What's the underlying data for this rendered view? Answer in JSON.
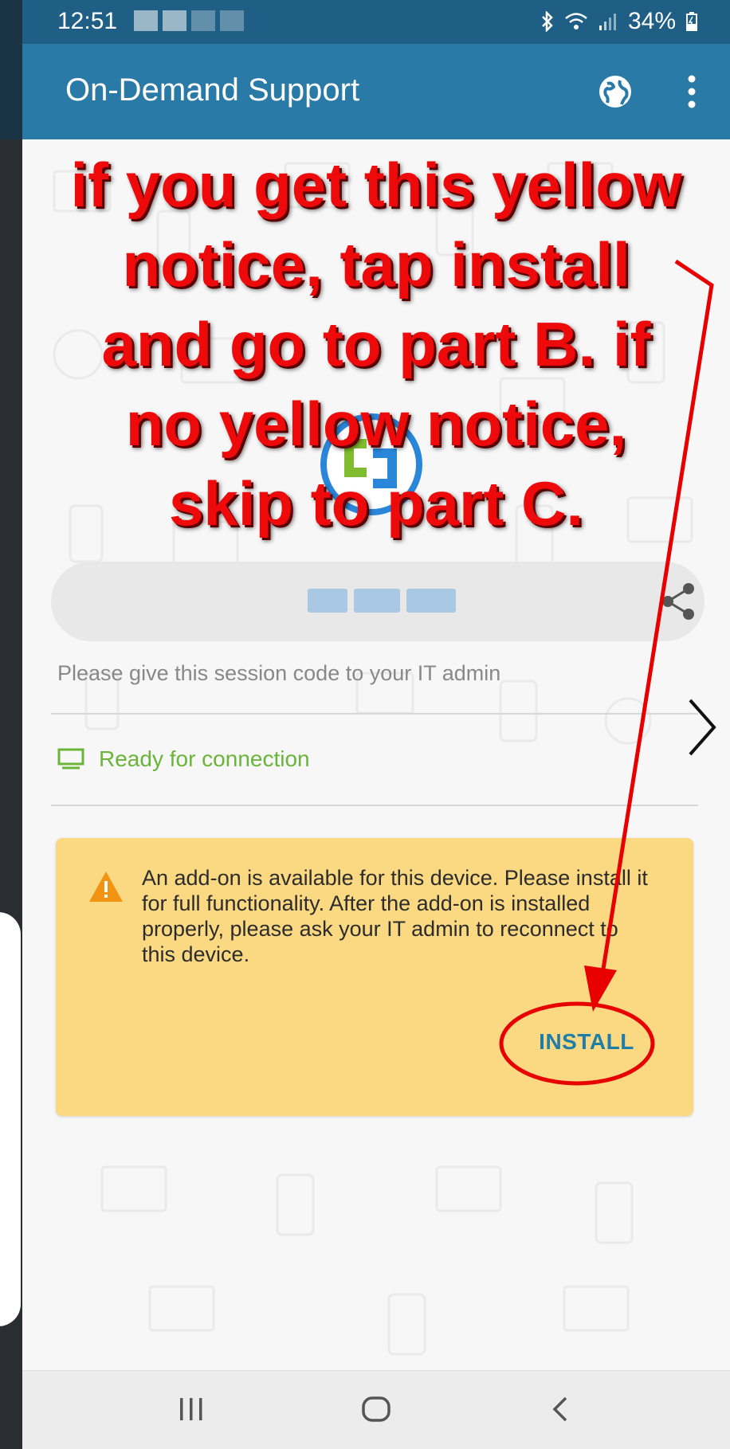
{
  "status_bar": {
    "time": "12:51",
    "battery": "34%"
  },
  "app_bar": {
    "title": "On-Demand Support"
  },
  "session": {
    "hint": "Please give this session code to your IT admin"
  },
  "connection": {
    "status": "Ready for connection",
    "status_color": "#6ab43a"
  },
  "notice": {
    "message": "An add-on is available for this device. Please install it for full functionality. After the add-on is installed properly, please ask your IT admin to reconnect to this device.",
    "button_label": "INSTALL",
    "background_color": "#fbd982"
  },
  "annotation": {
    "lines": [
      "if you get this yellow",
      "notice, tap install",
      "and go to part B. if",
      "no yellow notice,",
      "skip to part C."
    ],
    "color": "#ee0a0a"
  },
  "nav_bar": {
    "icons": [
      "recent-apps-icon",
      "home-icon",
      "back-icon"
    ]
  },
  "colors": {
    "status_bar": "#1f5f86",
    "app_bar": "#2a7aa7",
    "accent": "#1f7ea8"
  }
}
